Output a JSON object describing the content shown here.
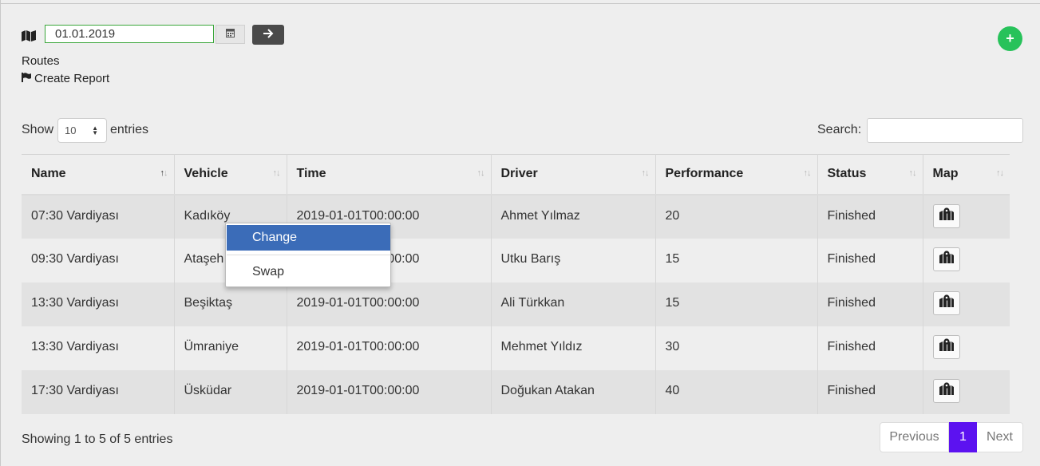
{
  "toolbar": {
    "date_value": "01.01.2019",
    "map_icon": "map-icon",
    "calendar_icon": "calendar-icon",
    "go_icon": "arrow-right-icon",
    "add_icon": "plus-icon",
    "add_label": "+",
    "accent_color": "#27c25a"
  },
  "section": {
    "routes_label": "Routes",
    "create_report_label": "Create Report",
    "create_report_icon": "flag-icon"
  },
  "length": {
    "show_label": "Show",
    "selected": "10",
    "entries_label": "entries"
  },
  "search": {
    "label": "Search:",
    "value": ""
  },
  "table": {
    "columns": [
      "Name",
      "Vehicle",
      "Time",
      "Driver",
      "Performance",
      "Status",
      "Map"
    ],
    "sort_glyph": "↑↓",
    "rows": [
      {
        "name": "07:30 Vardiyası",
        "vehicle": "Kadıköy",
        "time": "2019-01-01T00:00:00",
        "driver": "Ahmet Yılmaz",
        "performance": "20",
        "status": "Finished"
      },
      {
        "name": "09:30 Vardiyası",
        "vehicle": "Ataşeh",
        "time": "2019-01-01T00:00:00",
        "driver": "Utku Barış",
        "performance": "15",
        "status": "Finished"
      },
      {
        "name": "13:30 Vardiyası",
        "vehicle": "Beşiktaş",
        "time": "2019-01-01T00:00:00",
        "driver": "Ali Türkkan",
        "performance": "15",
        "status": "Finished"
      },
      {
        "name": "13:30 Vardiyası",
        "vehicle": "Ümraniye",
        "time": "2019-01-01T00:00:00",
        "driver": "Mehmet Yıldız",
        "performance": "30",
        "status": "Finished"
      },
      {
        "name": "17:30 Vardiyası",
        "vehicle": "Üsküdar",
        "time": "2019-01-01T00:00:00",
        "driver": "Doğukan Atakan",
        "performance": "40",
        "status": "Finished"
      }
    ],
    "map_button_icon": "map-marker-icon"
  },
  "footer": {
    "info": "Showing 1 to 5 of 5 entries",
    "prev": "Previous",
    "current_page": "1",
    "next": "Next",
    "current_color": "#5c12f0"
  },
  "context_menu": {
    "items": [
      "Change",
      "Swap"
    ],
    "highlight_color": "#3b6cb8"
  }
}
